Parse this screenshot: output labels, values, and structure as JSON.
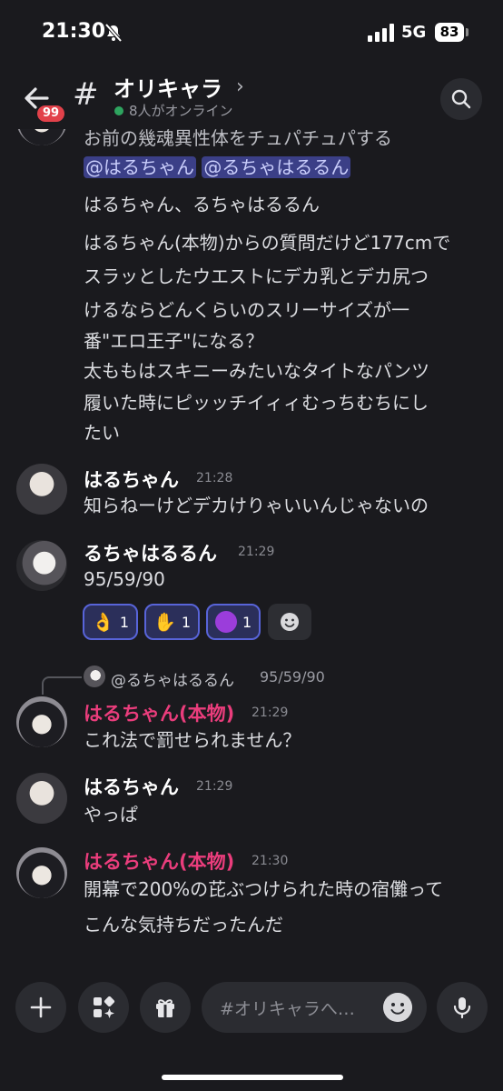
{
  "status_bar": {
    "time": "21:30",
    "network": "5G",
    "battery": "83"
  },
  "header": {
    "unread_badge": "99",
    "channel_name": "オリキャラ",
    "online_text": "8人がオンライン"
  },
  "messages": {
    "first": {
      "cut_line": "お前の幾魂異性体をチュパチュパする",
      "mention1": "@はるちゃん",
      "mention2": "@るちゃはるるん",
      "lines": [
        "はるちゃん、るちゃはるるん",
        "はるちゃん(本物)からの質問だけど177cmで",
        "スラッとしたウエストにデカ乳とデカ尻つ",
        "けるならどんくらいのスリーサイズが一",
        "番\"エロ王子\"になる？",
        "太ももはスキニーみたいなタイトなパンツ",
        "履いた時にピッッチイィィむっちむちにし",
        "たい"
      ]
    },
    "m2": {
      "author": "はるちゃん",
      "time": "21:28",
      "text": "知らねーけどデカけりゃいいんじゃないの"
    },
    "m3": {
      "author": "るちゃはるるん",
      "time": "21:29",
      "text": "95/59/90",
      "reactions": [
        {
          "emoji": "pinching-hand-emoji",
          "count": "1"
        },
        {
          "emoji": "palm-up-hand-emoji",
          "count": "1"
        },
        {
          "emoji": "purple-circle-emoji",
          "count": "1"
        }
      ]
    },
    "m4": {
      "reply_author": "@るちゃはるるん",
      "reply_text": "95/59/90",
      "author": "はるちゃん(本物)",
      "time": "21:29",
      "text": "これ法で罰せられません？"
    },
    "m5": {
      "author": "はるちゃん",
      "time": "21:29",
      "text": "やっぱ"
    },
    "m6": {
      "author": "はるちゃん(本物)",
      "time": "21:30",
      "lines": [
        "開幕で200%の芘ぶつけられた時の宿儺って",
        "こんな気持ちだったんだ"
      ]
    }
  },
  "composer": {
    "placeholder": "#オリキャラへ…"
  },
  "colors": {
    "background": "#1a1a1e",
    "mention_bg": "#3b3f87",
    "pink_author": "#ea3d7c",
    "online": "#2ea45f",
    "badge": "#e2414a"
  }
}
